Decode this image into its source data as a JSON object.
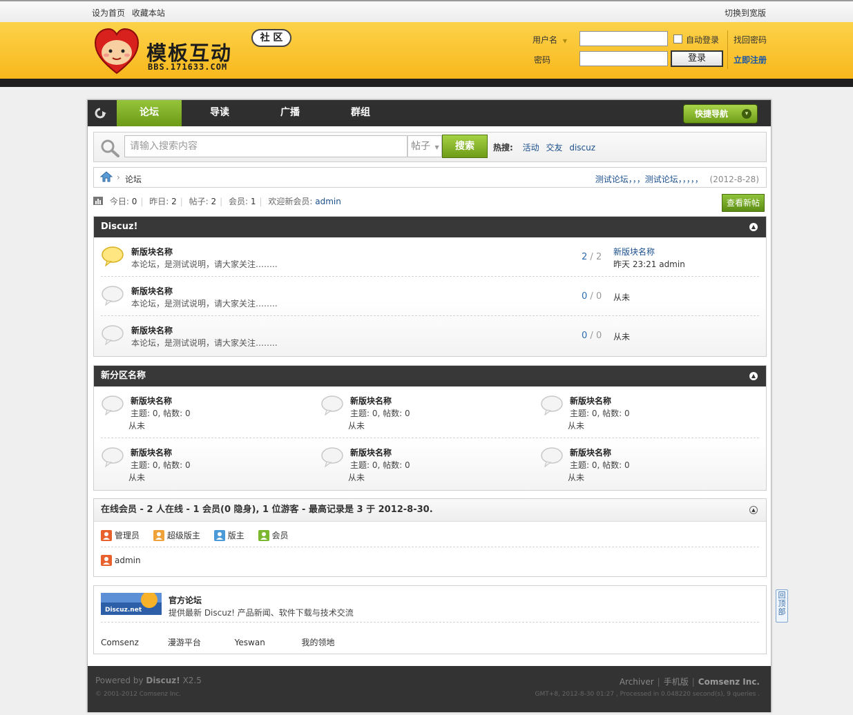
{
  "topbar": {
    "set_home": "设为首页",
    "bookmark": "收藏本站",
    "switch_width": "切换到宽版"
  },
  "header": {
    "logo_title": "模板互动",
    "logo_url": "BBS.171633.COM",
    "logo_badge": "社 区",
    "username_label": "用户名",
    "password_label": "密码",
    "auto_login": "自动登录",
    "login_button": "登录",
    "forgot_password": "找回密码",
    "register": "立即注册",
    "accent_color": "#f9c12a"
  },
  "nav": {
    "tabs": [
      "论坛",
      "导读",
      "广播",
      "群组"
    ],
    "active": "论坛",
    "quick_nav": "快捷导航"
  },
  "search": {
    "placeholder": "请输入搜索内容",
    "type": "帖子",
    "button": "搜索",
    "hot_label": "热搜:",
    "hot": [
      "活动",
      "交友",
      "discuz"
    ]
  },
  "breadcrumb": {
    "current": "论坛",
    "announcement": "测试论坛，，，测试论坛，，，，，",
    "date": "(2012-8-28)"
  },
  "stats": {
    "today_label": "今日:",
    "today": "0",
    "yesterday_label": "昨日:",
    "yesterday": "2",
    "posts_label": "帖子:",
    "posts": "2",
    "members_label": "会员:",
    "members": "1",
    "welcome_label": "欢迎新会员:",
    "newest_member": "admin",
    "new_post_button": "查看新帖"
  },
  "category1": {
    "title": "Discuz!",
    "forums": [
      {
        "name": "新版块名称",
        "desc": "本论坛，是测试说明，请大家关注……..",
        "threads": "2",
        "posts": "2",
        "last_title": "新版块名称",
        "last_info": "昨天 23:21 admin",
        "has_new": true
      },
      {
        "name": "新版块名称",
        "desc": "本论坛，是测试说明，请大家关注……..",
        "threads": "0",
        "posts": "0",
        "last_info": "从未",
        "has_new": false
      },
      {
        "name": "新版块名称",
        "desc": "本论坛，是测试说明，请大家关注……..",
        "threads": "0",
        "posts": "0",
        "last_info": "从未",
        "has_new": false
      }
    ]
  },
  "category2": {
    "title": "新分区名称",
    "forums": [
      {
        "name": "新版块名称",
        "stat": "主题: 0, 帖数: 0",
        "last": "从未"
      },
      {
        "name": "新版块名称",
        "stat": "主题: 0, 帖数: 0",
        "last": "从未"
      },
      {
        "name": "新版块名称",
        "stat": "主题: 0, 帖数: 0",
        "last": "从未"
      },
      {
        "name": "新版块名称",
        "stat": "主题: 0, 帖数: 0",
        "last": "从未"
      },
      {
        "name": "新版块名称",
        "stat": "主题: 0, 帖数: 0",
        "last": "从未"
      },
      {
        "name": "新版块名称",
        "stat": "主题: 0, 帖数: 0",
        "last": "从未"
      }
    ]
  },
  "online": {
    "title": "在线会员 - 2 人在线 - 1 会员(0 隐身), 1 位游客 - 最高记录是 3 于 2012-8-30.",
    "legend": [
      "管理员",
      "超级版主",
      "版主",
      "会员"
    ],
    "legend_colors": [
      "#e8602c",
      "#f0a23a",
      "#4a9ad8",
      "#7cb82f"
    ],
    "users": [
      "admin"
    ]
  },
  "links": {
    "banner_text": "Discuz.net",
    "name": "官方论坛",
    "desc": "提供最新 Discuz! 产品新闻、软件下载与技术交流",
    "text_links": [
      "Comsenz",
      "漫游平台",
      "Yeswan",
      "我的领地"
    ]
  },
  "footer": {
    "powered_prefix": "Powered by",
    "powered_name": "Discuz!",
    "version": "X2.5",
    "copyright": "© 2001-2012 Comsenz Inc.",
    "links": [
      "Archiver",
      "手机版",
      "Comsenz Inc."
    ],
    "gmt": "GMT+8, 2012-8-30 01:27 , Processed in 0.048220 second(s), 9 queries ."
  },
  "totop": "回顶部"
}
